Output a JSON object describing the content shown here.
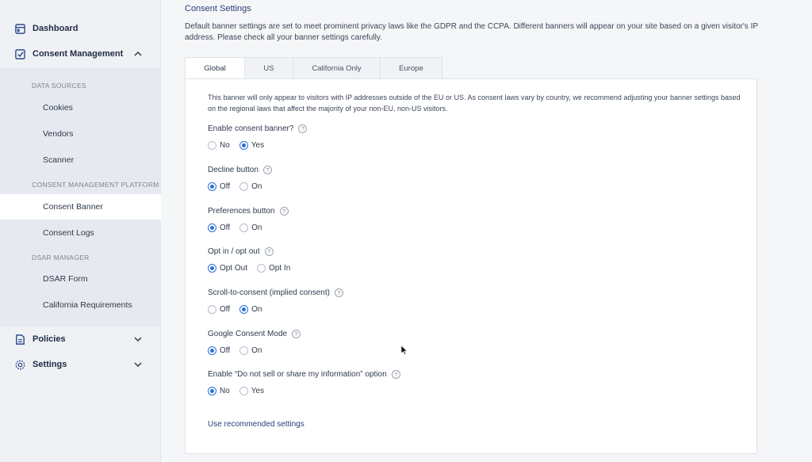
{
  "sidebar": {
    "dashboard": "Dashboard",
    "consent_management": "Consent Management",
    "sections": {
      "data_sources": "DATA SOURCES",
      "cmp": "CONSENT MANAGEMENT PLATFORM",
      "dsar": "DSAR MANAGER"
    },
    "items": {
      "cookies": "Cookies",
      "vendors": "Vendors",
      "scanner": "Scanner",
      "consent_banner": "Consent Banner",
      "consent_logs": "Consent Logs",
      "dsar_form": "DSAR Form",
      "california": "California Requirements"
    },
    "policies": "Policies",
    "settings": "Settings"
  },
  "main": {
    "title": "Consent Settings",
    "description": "Default banner settings are set to meet prominent privacy laws like the GDPR and the CCPA. Different banners will appear on your site based on a given visitor's IP address. Please check all your banner settings carefully.",
    "tabs": [
      "Global",
      "US",
      "California Only",
      "Europe"
    ],
    "intro": "This banner will only appear to visitors with IP addresses outside of the EU or US. As consent laws vary by country, we recommend adjusting your banner settings based on the regional laws that affect the majority of your non-EU, non-US visitors.",
    "help_glyph": "?",
    "settings": [
      {
        "label": "Enable consent banner?",
        "options": [
          "No",
          "Yes"
        ],
        "selected": 1
      },
      {
        "label": "Decline button",
        "options": [
          "Off",
          "On"
        ],
        "selected": 0
      },
      {
        "label": "Preferences button",
        "options": [
          "Off",
          "On"
        ],
        "selected": 0
      },
      {
        "label": "Opt in / opt out",
        "options": [
          "Opt Out",
          "Opt In"
        ],
        "selected": 0
      },
      {
        "label": "Scroll-to-consent (implied consent)",
        "options": [
          "Off",
          "On"
        ],
        "selected": 1
      },
      {
        "label": "Google Consent Mode",
        "options": [
          "Off",
          "On"
        ],
        "selected": 0
      },
      {
        "label": "Enable “Do not sell or share my information” option",
        "options": [
          "No",
          "Yes"
        ],
        "selected": 0
      }
    ],
    "recommended_link": "Use recommended settings"
  },
  "colors": {
    "accent": "#2b6fd6",
    "nav_text": "#1f2a44",
    "title": "#2d3d74"
  },
  "icons": {
    "dashboard": "dashboard-icon",
    "consent": "checkbox-icon",
    "policies": "document-icon",
    "settings": "gear-icon"
  }
}
